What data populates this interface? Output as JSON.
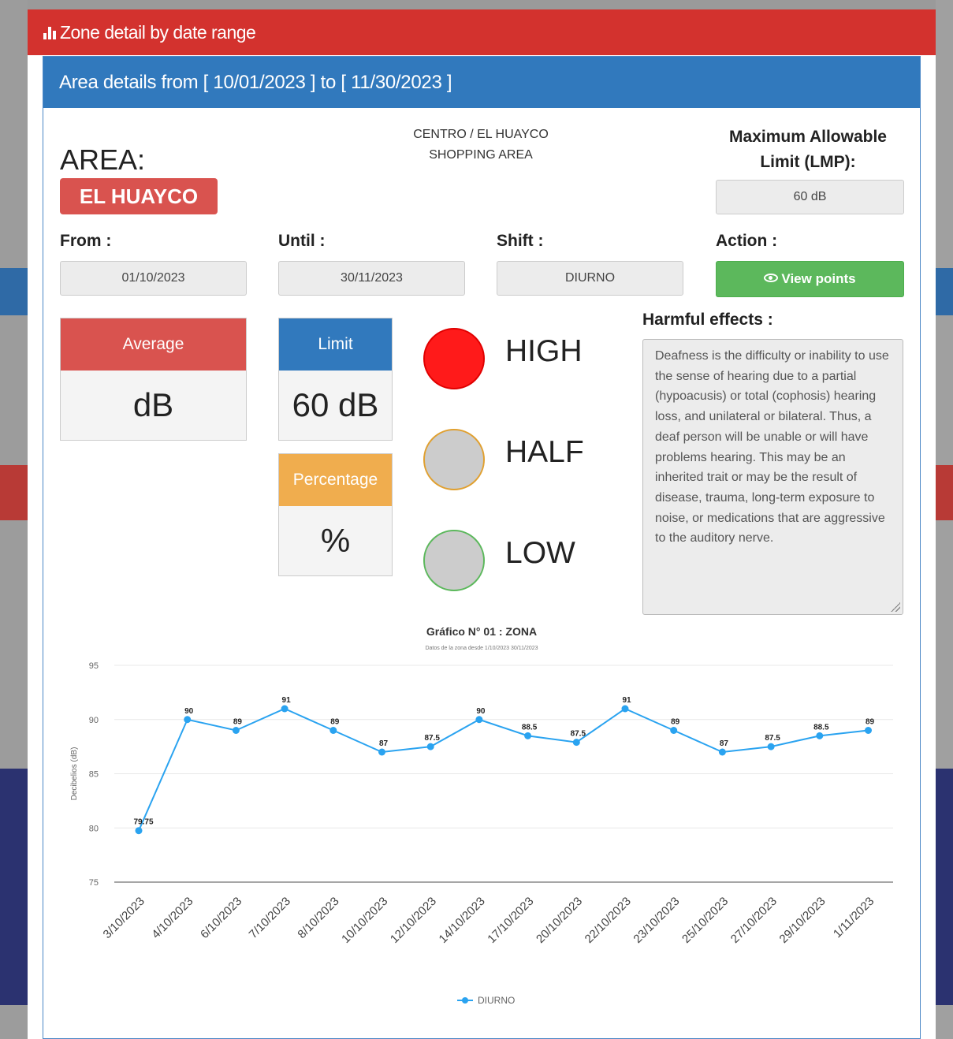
{
  "modal": {
    "title": "Zone detail by date range",
    "panel_heading": "Area details from [ 10/01/2023 ] to [ 11/30/2023 ]"
  },
  "area": {
    "label": "AREA:",
    "name": "EL HUAYCO",
    "district": "CENTRO / EL HUAYCO",
    "type": "SHOPPING AREA"
  },
  "lmp": {
    "title": "Maximum Allowable Limit (LMP):",
    "value": "60 dB"
  },
  "filters": {
    "from_label": "From :",
    "from_value": "01/10/2023",
    "until_label": "Until :",
    "until_value": "30/11/2023",
    "shift_label": "Shift :",
    "shift_value": "DIURNO",
    "action_label": "Action :",
    "view_points": "View points"
  },
  "stats": {
    "average_label": "Average",
    "average_value": "dB",
    "limit_label": "Limit",
    "limit_value": "60 dB",
    "percentage_label": "Percentage",
    "percentage_value": "%"
  },
  "levels": [
    {
      "label": "HIGH",
      "color": "#ff1a1a",
      "border": "#e00000"
    },
    {
      "label": "HALF",
      "color": "#cccccc",
      "border": "#e0a030"
    },
    {
      "label": "LOW",
      "color": "#cccccc",
      "border": "#5cb85c"
    }
  ],
  "harmful": {
    "title": "Harmful effects :",
    "text": "Deafness is the difficulty or inability to use the sense of hearing due to a partial (hypoacusis) or total (cophosis) hearing loss, and unilateral or bilateral. Thus, a deaf person will be unable or will have problems hearing. This may be an inherited trait or may be the result of disease, trauma, long-term exposure to noise, or medications that are aggressive to the auditory nerve."
  },
  "colors": {
    "header_red": "#d3322e",
    "panel_blue": "#3179bd",
    "average_red": "#d9534f",
    "limit_blue": "#3179bd",
    "percentage_orange": "#f0ad4e",
    "button_green": "#5cb85c",
    "series_blue": "#2aa3f0"
  },
  "chart_data": {
    "type": "line",
    "title": "Gráfico N° 01 : ZONA",
    "subtitle": "Datos de la zona desde 1/10/2023 30/11/2023",
    "ylabel": "Decibelios (dB)",
    "xlabel": "",
    "ylim": [
      75,
      95
    ],
    "yticks": [
      75,
      80,
      85,
      90,
      95
    ],
    "x": [
      "3/10/2023",
      "4/10/2023",
      "6/10/2023",
      "7/10/2023",
      "8/10/2023",
      "10/10/2023",
      "12/10/2023",
      "14/10/2023",
      "17/10/2023",
      "20/10/2023",
      "22/10/2023",
      "23/10/2023",
      "25/10/2023",
      "27/10/2023",
      "29/10/2023",
      "1/11/2023"
    ],
    "series": [
      {
        "name": "DIURNO",
        "values": [
          79.75,
          90,
          89,
          91,
          89,
          87,
          87.5,
          90,
          88.5,
          87.9,
          91,
          89,
          87,
          87.5,
          88.5,
          89
        ],
        "labels": [
          "79.75",
          "90",
          "89",
          "91",
          "89",
          "87",
          "87.5",
          "90",
          "88.5",
          "87.5",
          "91",
          "89",
          "87",
          "87.5",
          "88.5",
          "89"
        ]
      }
    ],
    "legend": "bottom-center",
    "grid": true
  }
}
